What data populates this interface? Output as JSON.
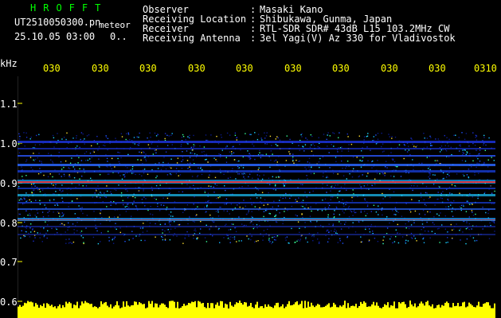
{
  "header": {
    "station": "HROFFT",
    "filename": "UT2510050300.pn",
    "meteor_label": "meteor",
    "datetime": "25.10.05 03:00",
    "count": "0.."
  },
  "info_rows": [
    {
      "label": "Observer",
      "value": "Masaki Kano"
    },
    {
      "label": "Receiving Location",
      "value": "Shibukawa, Gunma, Japan"
    },
    {
      "label": "Receiver",
      "value": "RTL-SDR SDR# 43dB L15 103.2MHz CW"
    },
    {
      "label": "Receiving Antenna",
      "value": "3el Yagi(V) Az 330 for Vladivostok"
    }
  ],
  "axis": {
    "y_unit": "kHz",
    "y_ticks": [
      "1.1",
      "1.0",
      "0.9",
      "0.8",
      "0.7",
      "0.6"
    ],
    "x_ticks": [
      "030",
      "030",
      "030",
      "030",
      "030",
      "030",
      "030",
      "030",
      "030",
      "0310"
    ]
  },
  "colors": {
    "background": "#000000",
    "header_green": "#00ff00",
    "tick_yellow": "#ffff00",
    "noise_yellow": "#ffff00"
  }
}
